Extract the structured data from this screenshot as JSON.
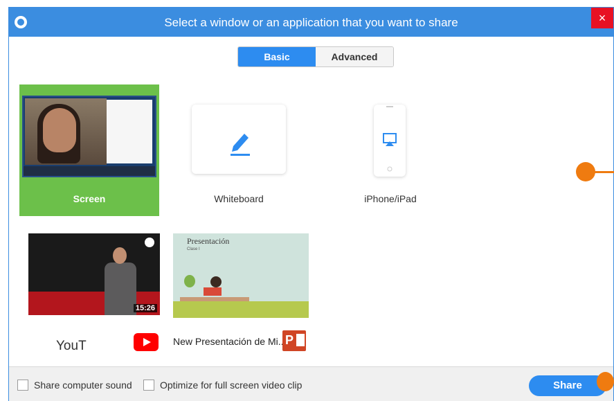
{
  "window": {
    "title": "Select a window or an application that you want to share",
    "close_glyph": "×",
    "accent_color": "#3b8de0",
    "close_color": "#e81123"
  },
  "tabs": [
    {
      "label": "Basic",
      "active": true
    },
    {
      "label": "Advanced",
      "active": false
    }
  ],
  "tiles": {
    "screen": {
      "label": "Screen",
      "selected": true,
      "highlight_color": "#6cc04a"
    },
    "whiteboard": {
      "label": "Whiteboard",
      "icon": "pen-icon"
    },
    "iphone": {
      "label": "iPhone/iPad",
      "icon": "airplay-icon"
    },
    "youtube": {
      "label": "YouT",
      "duration": "15:26",
      "icon": "youtube-logo"
    },
    "presentation": {
      "label": "New Presentación de Mi...",
      "slide_title": "Presentación",
      "slide_subtitle": "Clase I",
      "icon": "powerpoint-logo",
      "logo_letter": "P"
    }
  },
  "footer": {
    "share_sound_label": "Share computer sound",
    "share_sound_checked": false,
    "optimize_label": "Optimize for full screen video clip",
    "optimize_checked": false,
    "share_button": "Share"
  },
  "annotation_color": "#ef7b10"
}
